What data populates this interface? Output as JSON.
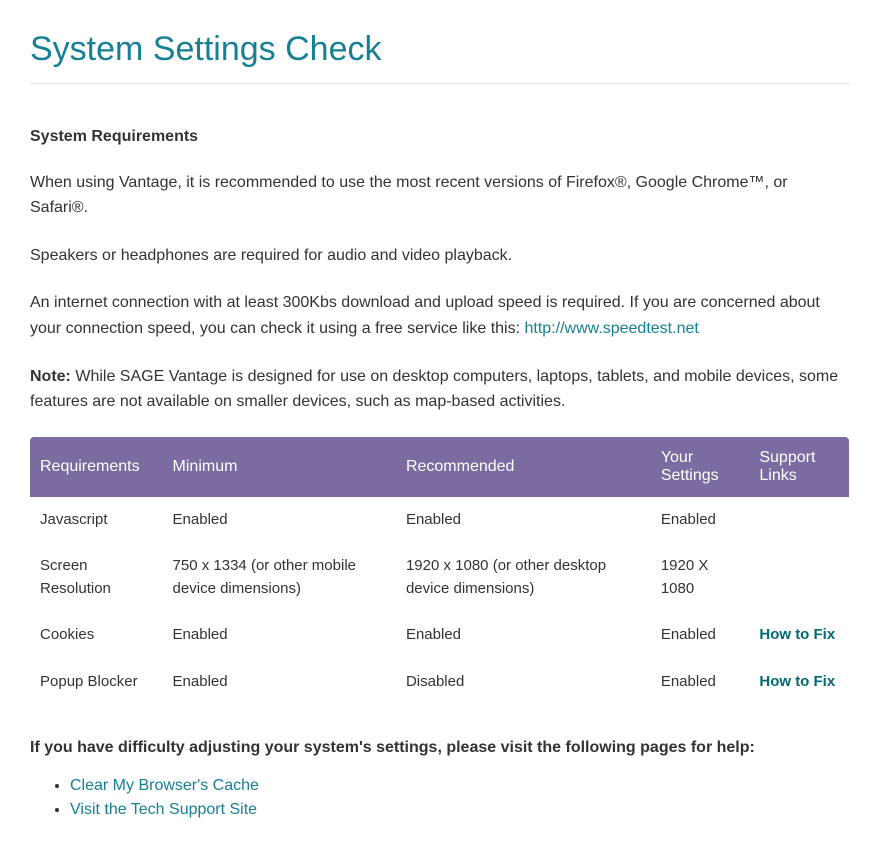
{
  "page": {
    "title": "System Settings Check"
  },
  "intro": {
    "heading": "System Requirements",
    "p1": "When using Vantage, it is recommended to use the most recent versions of Firefox®, Google Chrome™, or Safari®.",
    "p2": "Speakers or headphones are required for audio and video playback.",
    "p3_pre": "An internet connection with at least 300Kbs download and upload speed is required. If you are concerned about your connection speed, you can check it using a free service like this: ",
    "p3_link_text": "http://www.speedtest.net",
    "note_label": "Note:",
    "note_text": " While SAGE Vantage is designed for use on desktop computers, laptops, tablets, and mobile devices, some features are not available on smaller devices, such as map-based activities."
  },
  "table": {
    "headers": {
      "req": "Requirements",
      "min": "Minimum",
      "rec": "Recommended",
      "your": "Your Settings",
      "support": "Support Links"
    },
    "rows": [
      {
        "req": "Javascript",
        "min": "Enabled",
        "rec": "Enabled",
        "your": "Enabled",
        "support": ""
      },
      {
        "req": "Screen Resolution",
        "min": "750 x 1334 (or other mobile device dimensions)",
        "rec": "1920 x 1080 (or other desktop device dimensions)",
        "your": "1920 X 1080",
        "support": ""
      },
      {
        "req": "Cookies",
        "min": "Enabled",
        "rec": "Enabled",
        "your": "Enabled",
        "support": "How to Fix"
      },
      {
        "req": "Popup Blocker",
        "min": "Enabled",
        "rec": "Disabled",
        "your": "Enabled",
        "support": "How to Fix"
      }
    ]
  },
  "help": {
    "heading": "If you have difficulty adjusting your system's settings, please visit the following pages for help:",
    "links": [
      "Clear My Browser's Cache",
      "Visit the Tech Support Site"
    ]
  }
}
